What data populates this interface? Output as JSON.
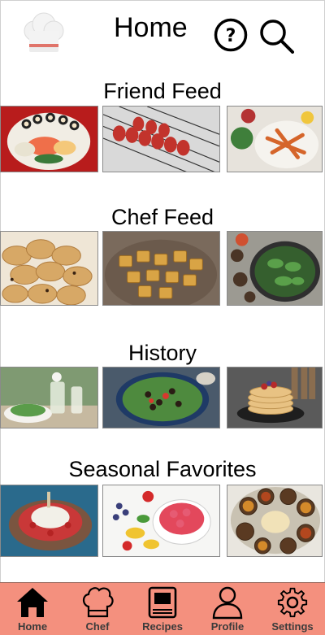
{
  "header": {
    "title": "Home",
    "logo_icon": "chef-hat-icon",
    "help_icon": "help-icon",
    "search_icon": "search-icon"
  },
  "sections": [
    {
      "title": "Friend Feed",
      "images": [
        "sushi-platter",
        "grilled-skewers",
        "vegetable-dish"
      ]
    },
    {
      "title": "Chef Feed",
      "images": [
        "cookies",
        "croutons",
        "salad-bowl"
      ]
    },
    {
      "title": "History",
      "images": [
        "salad-drinks",
        "salad-plate",
        "pancakes"
      ]
    },
    {
      "title": "Seasonal Favorites",
      "images": [
        "tart",
        "fruit-bowl",
        "indian-thali"
      ]
    }
  ],
  "nav": {
    "items": [
      {
        "label": "Home",
        "icon": "house-icon"
      },
      {
        "label": "Chef",
        "icon": "chef-hat-icon"
      },
      {
        "label": "Recipes",
        "icon": "recipe-book-icon"
      },
      {
        "label": "Profile",
        "icon": "user-icon"
      },
      {
        "label": "Settings",
        "icon": "gear-icon"
      }
    ],
    "background": "#f4907e"
  },
  "colors": {
    "nav_background": "#f4907e",
    "logo_stripe": "#e0746a"
  }
}
